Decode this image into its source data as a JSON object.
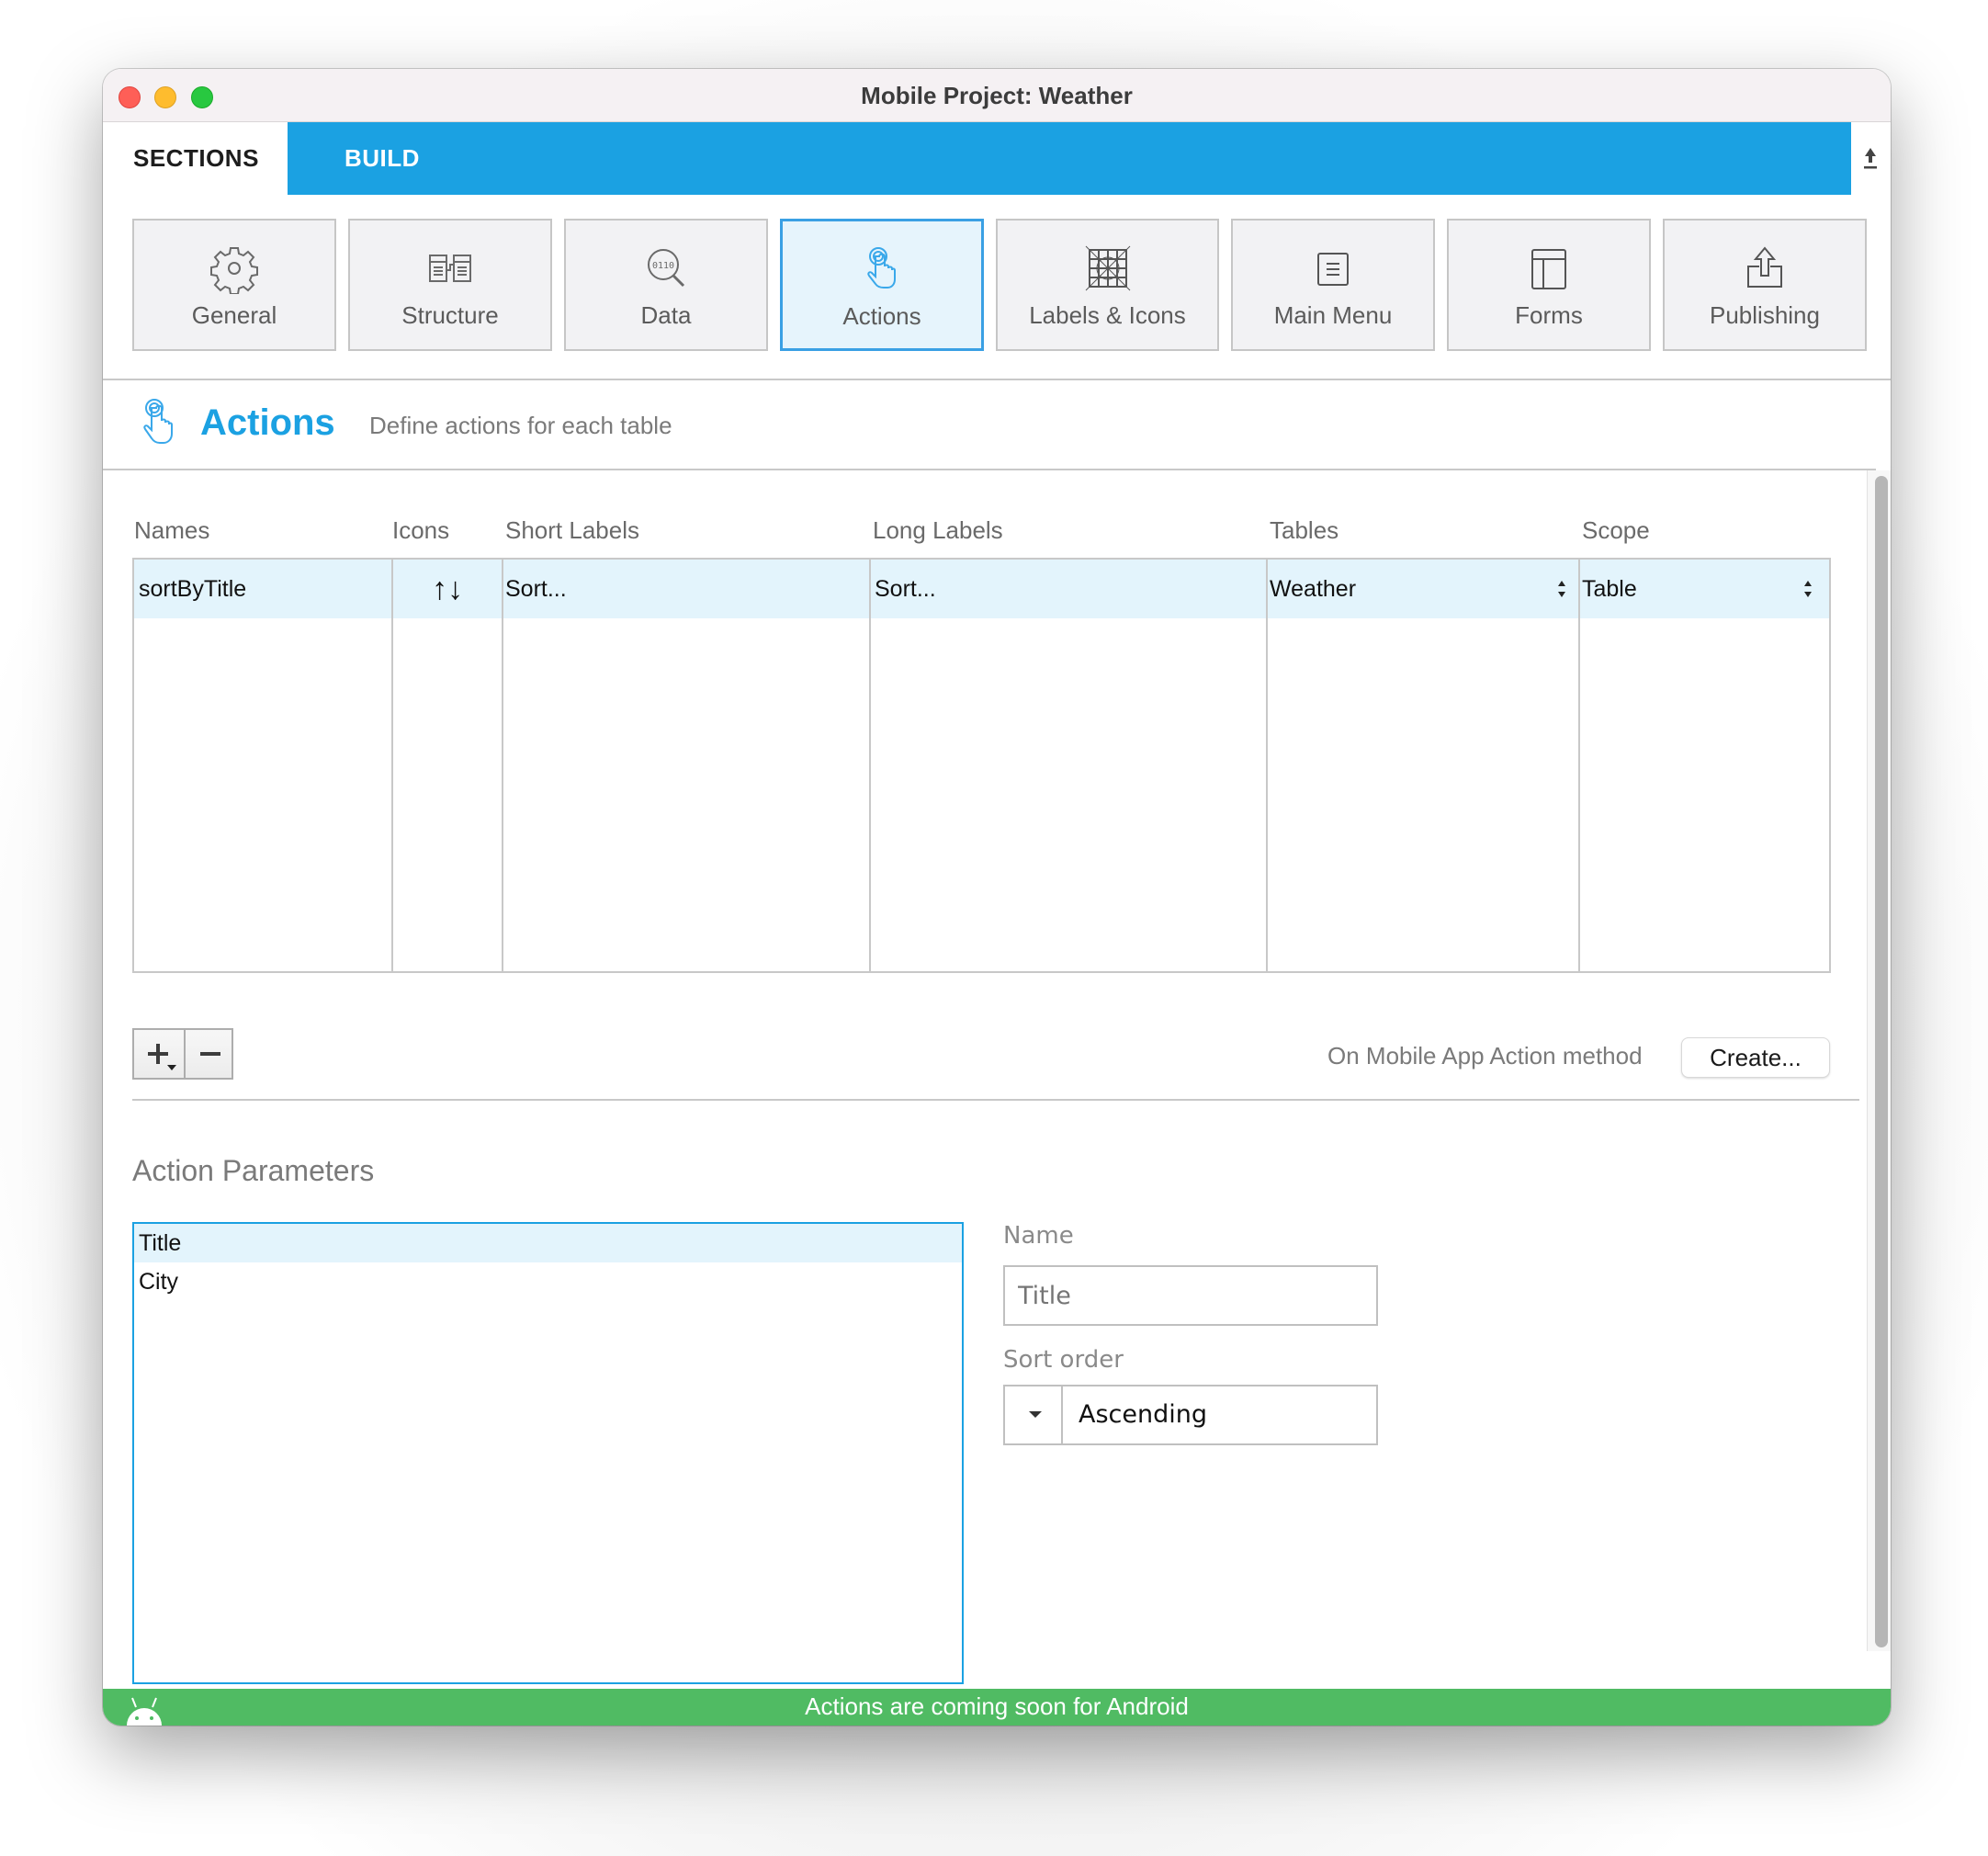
{
  "window": {
    "title": "Mobile Project: Weather"
  },
  "tabs": {
    "sections": "SECTIONS",
    "build": "BUILD",
    "upload_icon": "upload-icon"
  },
  "sections": [
    {
      "label": "General",
      "icon": "gear-icon",
      "active": false
    },
    {
      "label": "Structure",
      "icon": "structure-icon",
      "active": false
    },
    {
      "label": "Data",
      "icon": "data-search-icon",
      "active": false
    },
    {
      "label": "Actions",
      "icon": "tap-hand-icon",
      "active": true
    },
    {
      "label": "Labels & Icons",
      "icon": "labels-icons-icon",
      "active": false
    },
    {
      "label": "Main Menu",
      "icon": "menu-icon",
      "active": false
    },
    {
      "label": "Forms",
      "icon": "forms-icon",
      "active": false
    },
    {
      "label": "Publishing",
      "icon": "publish-icon",
      "active": false
    }
  ],
  "header": {
    "title": "Actions",
    "subtitle": "Define actions for each table",
    "accent": "#1ba1e2"
  },
  "actions_table": {
    "columns": [
      "Names",
      "Icons",
      "Short Labels",
      "Long Labels",
      "Tables",
      "Scope"
    ],
    "rows": [
      {
        "name": "sortByTitle",
        "icon": "sort-arrows-icon",
        "icon_glyph": "↑↓",
        "short_label": "Sort...",
        "long_label": "Sort...",
        "table": "Weather",
        "scope": "Table",
        "selected": true
      }
    ]
  },
  "method": {
    "label": "On Mobile App Action method",
    "create_button": "Create..."
  },
  "parameters": {
    "title": "Action Parameters",
    "items": [
      {
        "label": "Title",
        "selected": true
      },
      {
        "label": "City",
        "selected": false
      }
    ],
    "name_label": "Name",
    "name_placeholder": "Title",
    "sort_order_label": "Sort order",
    "sort_order_value": "Ascending"
  },
  "footer": {
    "message": "Actions are coming soon for Android",
    "color": "#50bb63"
  }
}
